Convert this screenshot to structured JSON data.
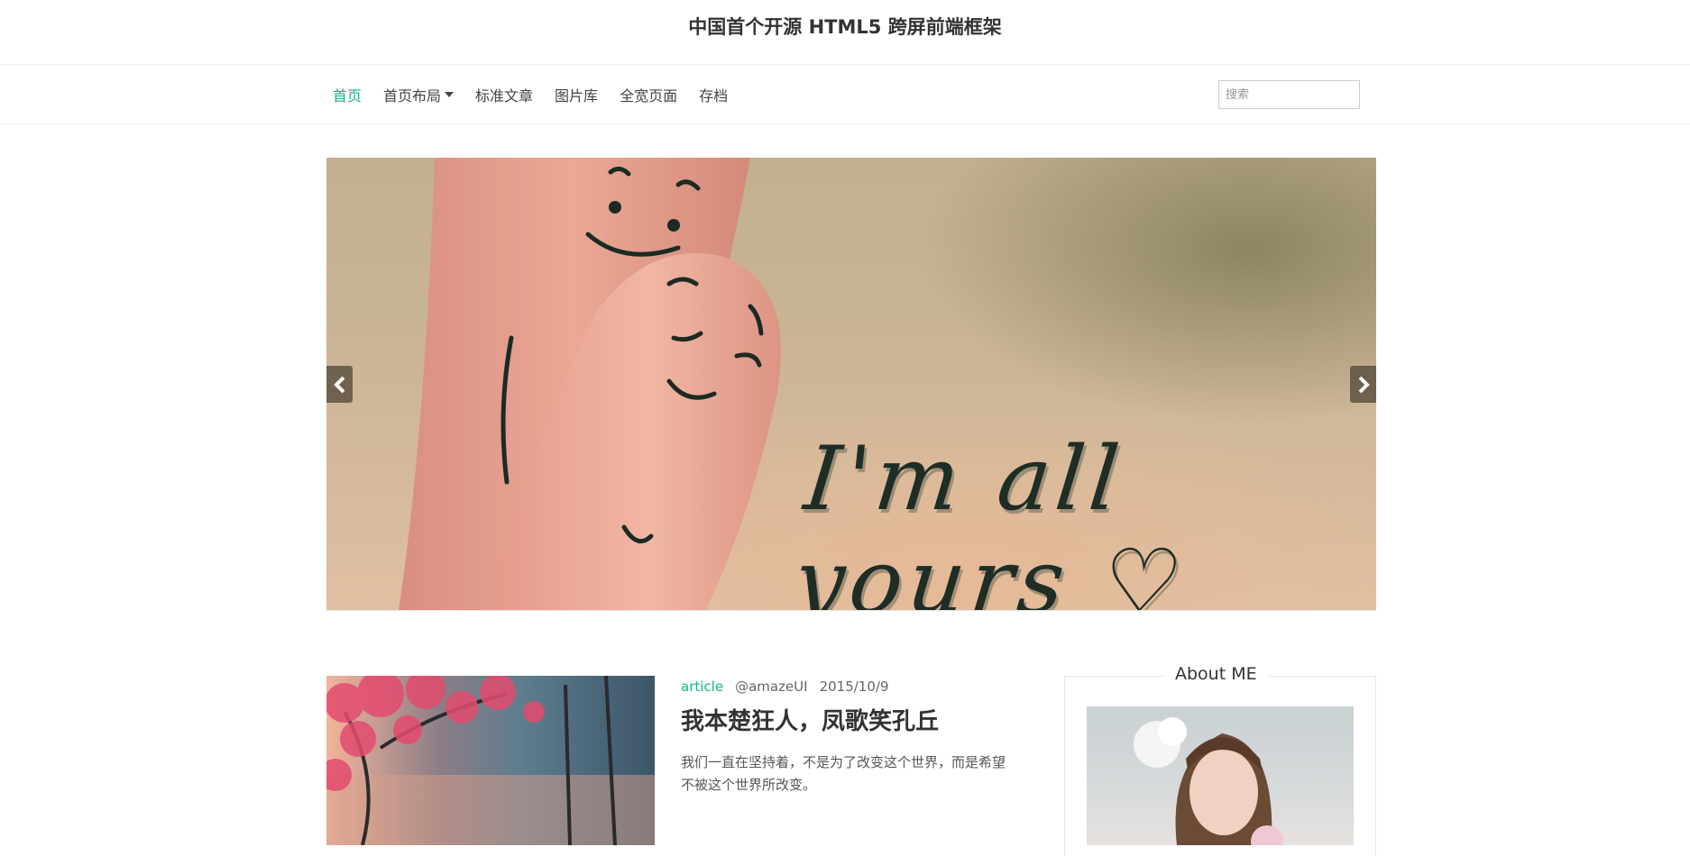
{
  "header": {
    "title": "中国首个开源 HTML5 跨屏前端框架"
  },
  "nav": {
    "items": [
      {
        "label": "首页",
        "active": true
      },
      {
        "label": "首页布局",
        "has_dropdown": true
      },
      {
        "label": "标准文章"
      },
      {
        "label": "图片库"
      },
      {
        "label": "全宽页面"
      },
      {
        "label": "存档"
      }
    ],
    "search": {
      "placeholder": "搜索",
      "value": ""
    }
  },
  "slider": {
    "caption": "I'm all yours ♡",
    "prev_icon": "chevron-left-icon",
    "next_icon": "chevron-right-icon"
  },
  "post": {
    "category": "article",
    "author": "@amazeUI",
    "date": "2015/10/9",
    "title": "我本楚狂人，凤歌笑孔丘",
    "excerpt": "我们一直在坚持着，不是为了改变这个世界，而是希望不被这个世界所改变。"
  },
  "sidebar": {
    "about_title": "About ME"
  },
  "colors": {
    "accent": "#10b68c",
    "text": "#333333",
    "border": "#eeeeee"
  }
}
